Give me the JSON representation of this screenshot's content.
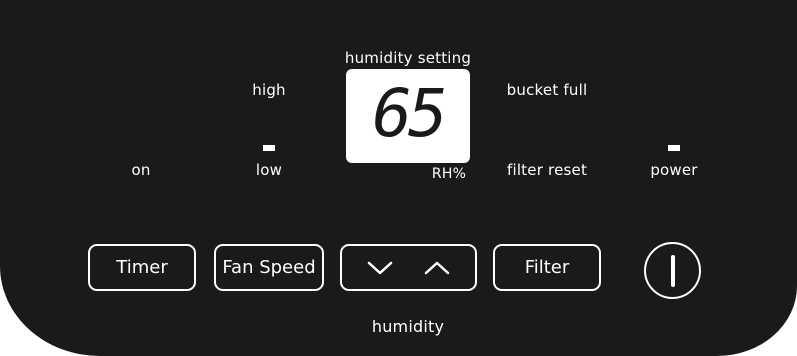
{
  "indicators": {
    "on": "on",
    "high": "high",
    "low": "low",
    "humidity_setting": "humidity setting",
    "rh_percent": "RH%",
    "bucket_full": "bucket full",
    "filter_reset": "filter reset",
    "power": "power"
  },
  "display": {
    "value": "65"
  },
  "buttons": {
    "timer": "Timer",
    "fan_speed": "Fan Speed",
    "filter": "Filter",
    "humidity_down_icon": "chevron-down-icon",
    "humidity_up_icon": "chevron-up-icon",
    "power_icon": "power-icon"
  },
  "humidity_group_label": "humidity",
  "colors": {
    "panel": "#1b1919",
    "foreground": "#ffffff"
  }
}
